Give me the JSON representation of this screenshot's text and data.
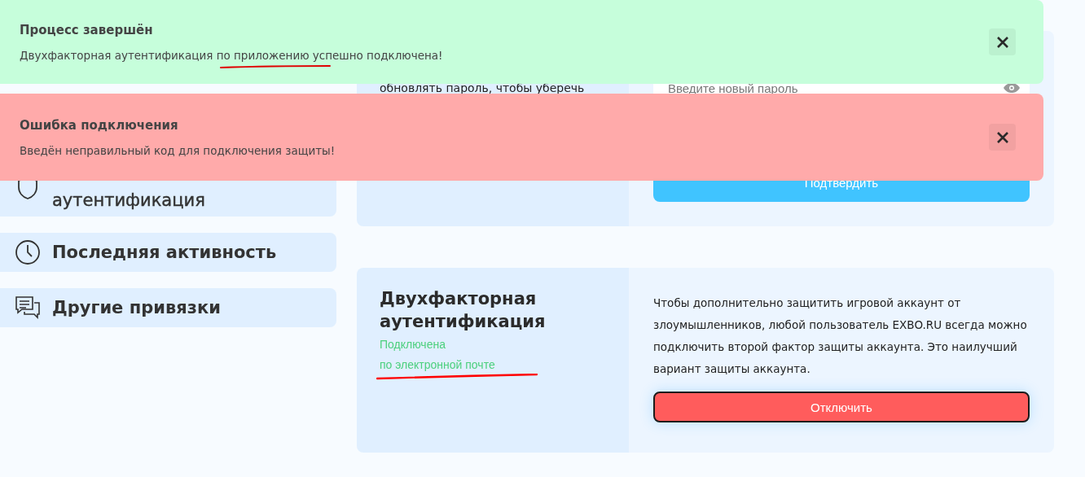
{
  "sidebar": {
    "items": [
      {
        "label": "аутентификация",
        "selected": false
      },
      {
        "label": "Последняя активность",
        "selected": false
      },
      {
        "label": "Другие привязки",
        "selected": false
      }
    ]
  },
  "password_card": {
    "description": "обновлять пароль, чтобы уберечь",
    "password_field": {
      "placeholder": "Введите новый пароль"
    },
    "confirm_button": "Подтвердить"
  },
  "two_factor_card": {
    "title": "Двухфакторная аутентификация",
    "status": "Подключена",
    "method": "по электронной почте",
    "description": "Чтобы дополнительно защитить игровой аккаунт от злоумышленников, любой пользователь EXBO.RU всегда можно подключить второй фактор защиты аккаунта. Это наилучший вариант защиты аккаунта.",
    "disable_button": "Отключить"
  },
  "notifications": [
    {
      "kind": "success",
      "title": "Процесс завершён",
      "message": "Двухфакторная аутентификация по приложению успешно подключена!"
    },
    {
      "kind": "error",
      "title": "Ошибка подключения",
      "message": "Введён неправильный код для подключения защиты!"
    }
  ]
}
